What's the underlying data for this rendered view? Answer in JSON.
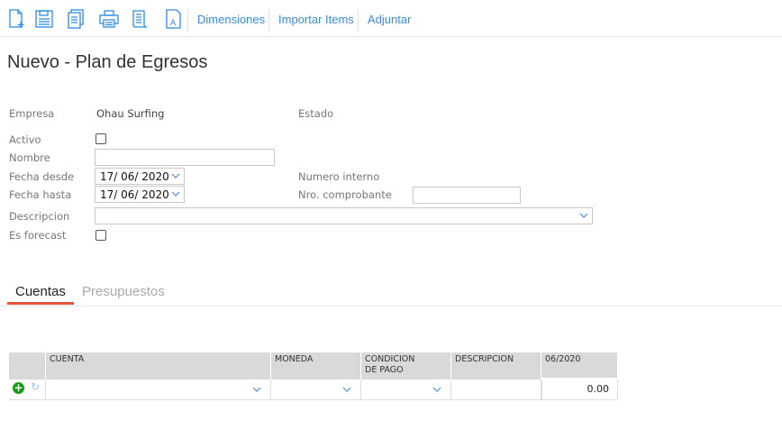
{
  "toolbar": {
    "icons": [
      "new-document-icon",
      "save-icon",
      "copy-icon",
      "print-icon",
      "scroll-icon",
      "font-document-icon"
    ],
    "links": [
      "Dimensiones",
      "Importar Items",
      "Adjuntar"
    ]
  },
  "page_title": "Nuevo - Plan de Egresos",
  "form": {
    "empresa_label": "Empresa",
    "empresa_value": "Ohau Surfing",
    "estado_label": "Estado",
    "activo_label": "Activo",
    "nombre_label": "Nombre",
    "nombre_value": "",
    "fecha_desde_label": "Fecha desde",
    "fecha_desde_value": "17/ 06/ 2020",
    "fecha_hasta_label": "Fecha hasta",
    "fecha_hasta_value": "17/ 06/ 2020",
    "numero_interno_label": "Numero interno",
    "nro_comprobante_label": "Nro. comprobante",
    "nro_comprobante_value": "",
    "descripcion_label": "Descripcion",
    "es_forecast_label": "Es forecast"
  },
  "tabs": [
    {
      "label": "Cuentas",
      "active": true
    },
    {
      "label": "Presupuestos",
      "active": false
    }
  ],
  "grid": {
    "headers": [
      "CUENTA",
      "MONEDA",
      "CONDICION DE PAGO",
      "DESCRIPCION",
      "06/2020"
    ],
    "row": {
      "amount": "0.00"
    }
  },
  "colors": {
    "accent": "#2b8ce6",
    "tab_underline": "#e8533a",
    "add_green": "#1a9a1a"
  }
}
